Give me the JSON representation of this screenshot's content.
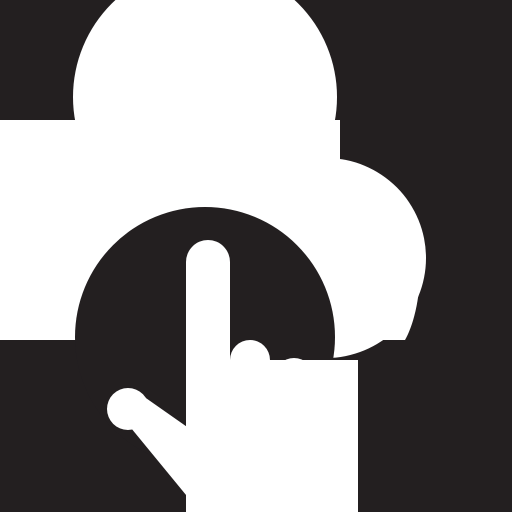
{
  "icon": {
    "name": "cloud-touch-icon",
    "colors": {
      "background": "#231f20",
      "foreground": "#ffffff"
    }
  }
}
